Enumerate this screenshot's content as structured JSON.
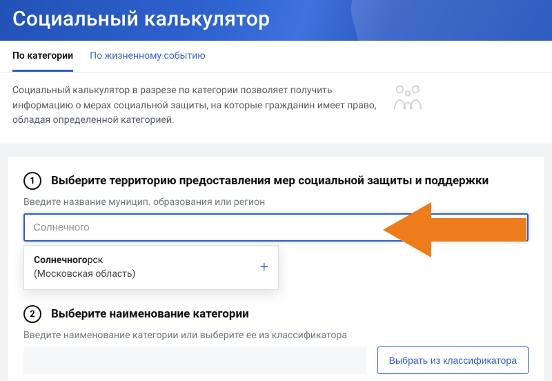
{
  "header": {
    "title": "Социальный калькулятор"
  },
  "tabs": {
    "items": [
      {
        "label": "По категории",
        "active": true
      },
      {
        "label": "По жизненному событию",
        "active": false
      }
    ]
  },
  "description": "Социальный калькулятор в разрезе по категории позволяет получить информацию о мерах социальной защиты, на которые гражданин имеет право, обладая определенной категорией.",
  "step1": {
    "num": "1",
    "title": "Выберите территорию предоставления мер социальной защиты и поддержки",
    "field_label": "Введите название муницип. образования или регион",
    "input_value": "Солнечного",
    "suggestion": {
      "match": "Солнечного",
      "rest": "рск",
      "sub": "(Московская область)",
      "plus": "+"
    }
  },
  "step2": {
    "num": "2",
    "title": "Выберите наименование категории",
    "field_label": "Введите наименование категории или выберите ее из классификатора",
    "button": "Выбрать из классификатора"
  }
}
